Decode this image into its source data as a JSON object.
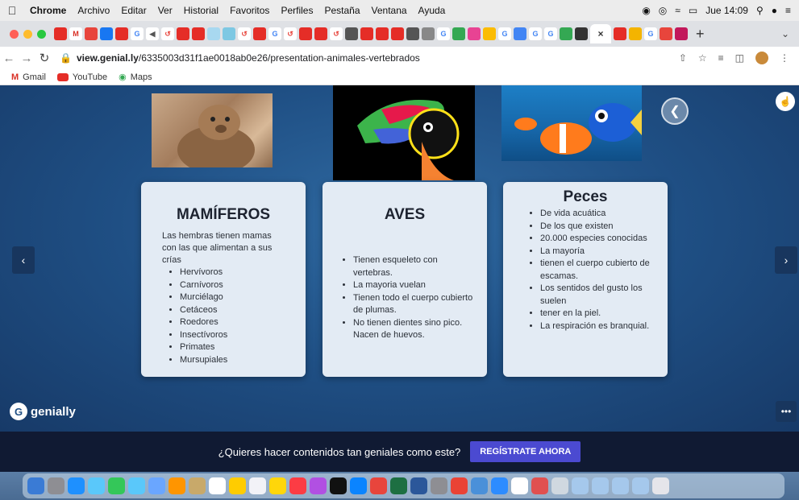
{
  "menubar": {
    "app": "Chrome",
    "items": [
      "Archivo",
      "Editar",
      "Ver",
      "Historial",
      "Favoritos",
      "Perfiles",
      "Pestaña",
      "Ventana",
      "Ayuda"
    ],
    "clock": "Jue 14:09"
  },
  "tabs": {
    "active_close": "×",
    "new_tab": "+"
  },
  "address": {
    "host": "view.genial.ly",
    "path": "/6335003d31f1ae0018ab0e26/presentation-animales-vertebrados"
  },
  "bookmarks": [
    "Gmail",
    "YouTube",
    "Maps"
  ],
  "cards": {
    "mamiferos": {
      "title": "MAMÍFEROS",
      "intro": "Las hembras tienen mamas con las que alimentan a sus crías",
      "items": [
        "Hervívoros",
        "Carnívoros",
        "Murciélago",
        "Cetáceos",
        "Roedores",
        "Insectívoros",
        "Primates",
        "Mursupiales"
      ]
    },
    "aves": {
      "title": "AVES",
      "items": [
        "Tienen esqueleto con vertebras.",
        "La mayoria vuelan",
        "Tienen todo el cuerpo cubierto de plumas.",
        "No tienen dientes sino pico. Nacen de huevos."
      ]
    },
    "peces": {
      "title": "Peces",
      "items": [
        "De vida acuática",
        "De los que existen",
        "20.000 especies conocidas",
        "La mayoría",
        "tienen el cuerpo cubierto de escamas.",
        "Los sentidos del gusto los suelen",
        "tener en la piel.",
        " La respiración es branquial."
      ]
    }
  },
  "brand": {
    "logo": "genially"
  },
  "cta": {
    "text": "¿Quieres hacer contenidos tan geniales como este?",
    "button": "REGÍSTRATE AHORA"
  },
  "colors": {
    "background": "#1f4f84",
    "card": "#e3ebf4",
    "cta_button": "#4b4ad1"
  }
}
